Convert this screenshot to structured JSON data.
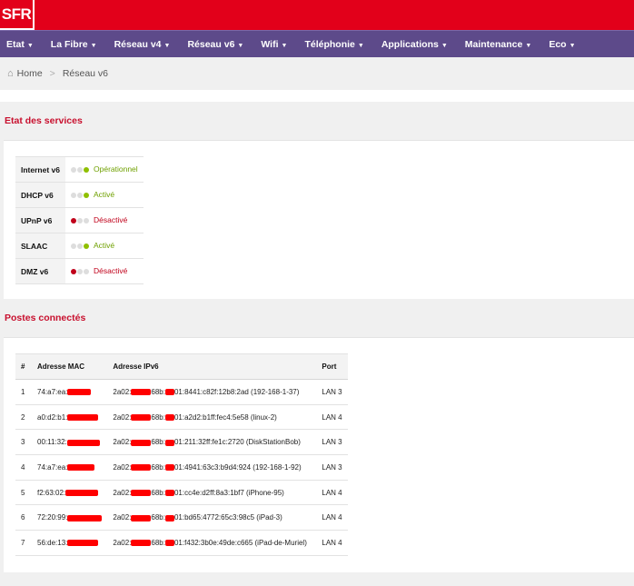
{
  "brand": {
    "logo": "SFR"
  },
  "nav": [
    {
      "label": "Etat"
    },
    {
      "label": "La Fibre"
    },
    {
      "label": "Réseau v4"
    },
    {
      "label": "Réseau v6"
    },
    {
      "label": "Wifi"
    },
    {
      "label": "Téléphonie"
    },
    {
      "label": "Applications"
    },
    {
      "label": "Maintenance"
    },
    {
      "label": "Eco"
    }
  ],
  "breadcrumb": {
    "home": "Home",
    "separator": ">",
    "current": "Réseau v6"
  },
  "services": {
    "title": "Etat des services",
    "rows": [
      {
        "name": "Internet v6",
        "status": "Opérationnel",
        "state": "on"
      },
      {
        "name": "DHCP v6",
        "status": "Activé",
        "state": "on"
      },
      {
        "name": "UPnP v6",
        "status": "Désactivé",
        "state": "off"
      },
      {
        "name": "SLAAC",
        "status": "Activé",
        "state": "on"
      },
      {
        "name": "DMZ v6",
        "status": "Désactivé",
        "state": "off"
      }
    ]
  },
  "hosts": {
    "title": "Postes connectés",
    "columns": {
      "num": "#",
      "mac": "Adresse MAC",
      "ipv6": "Adresse IPv6",
      "port": "Port"
    },
    "rows": [
      {
        "num": "1",
        "mac_prefix": "74:a7:ea:",
        "ip_prefix": "2a02:",
        "ip_mid": "68b:",
        "ip_suffix": "01:8441:c82f:12b8:2ad (192-168-1-37)",
        "port": "LAN 3"
      },
      {
        "num": "2",
        "mac_prefix": "a0:d2:b1:",
        "ip_prefix": "2a02:",
        "ip_mid": "68b:",
        "ip_suffix": "01:a2d2:b1ff:fec4:5e58 (linux-2)",
        "port": "LAN 4"
      },
      {
        "num": "3",
        "mac_prefix": "00:11:32:",
        "ip_prefix": "2a02:",
        "ip_mid": "68b:",
        "ip_suffix": "01:211:32ff:fe1c:2720 (DiskStationBob)",
        "port": "LAN 3"
      },
      {
        "num": "4",
        "mac_prefix": "74:a7:ea:",
        "ip_prefix": "2a02:",
        "ip_mid": "68b:",
        "ip_suffix": "01:4941:63c3:b9d4:924 (192-168-1-92)",
        "port": "LAN 3"
      },
      {
        "num": "5",
        "mac_prefix": "f2:63:02:",
        "ip_prefix": "2a02:",
        "ip_mid": "68b:",
        "ip_suffix": "01:cc4e:d2ff:8a3:1bf7 (iPhone-95)",
        "port": "LAN 4"
      },
      {
        "num": "6",
        "mac_prefix": "72:20:99:",
        "ip_prefix": "2a02:",
        "ip_mid": "68b:",
        "ip_suffix": "01:bd65:4772:65c3:98c5 (iPad-3)",
        "port": "LAN 4"
      },
      {
        "num": "7",
        "mac_prefix": "56:de:13:",
        "ip_prefix": "2a02:",
        "ip_mid": "68b:",
        "ip_suffix": "01:f432:3b0e:49de:c665 (iPad-de-Muriel)",
        "port": "LAN 4"
      }
    ]
  },
  "colors": {
    "brand_red": "#e2001a",
    "nav_purple": "#5d4a8a",
    "title_red": "#c8102e",
    "ok_green": "#8fbf00",
    "off_red": "#c0001a",
    "redaction": "#ff0000"
  }
}
